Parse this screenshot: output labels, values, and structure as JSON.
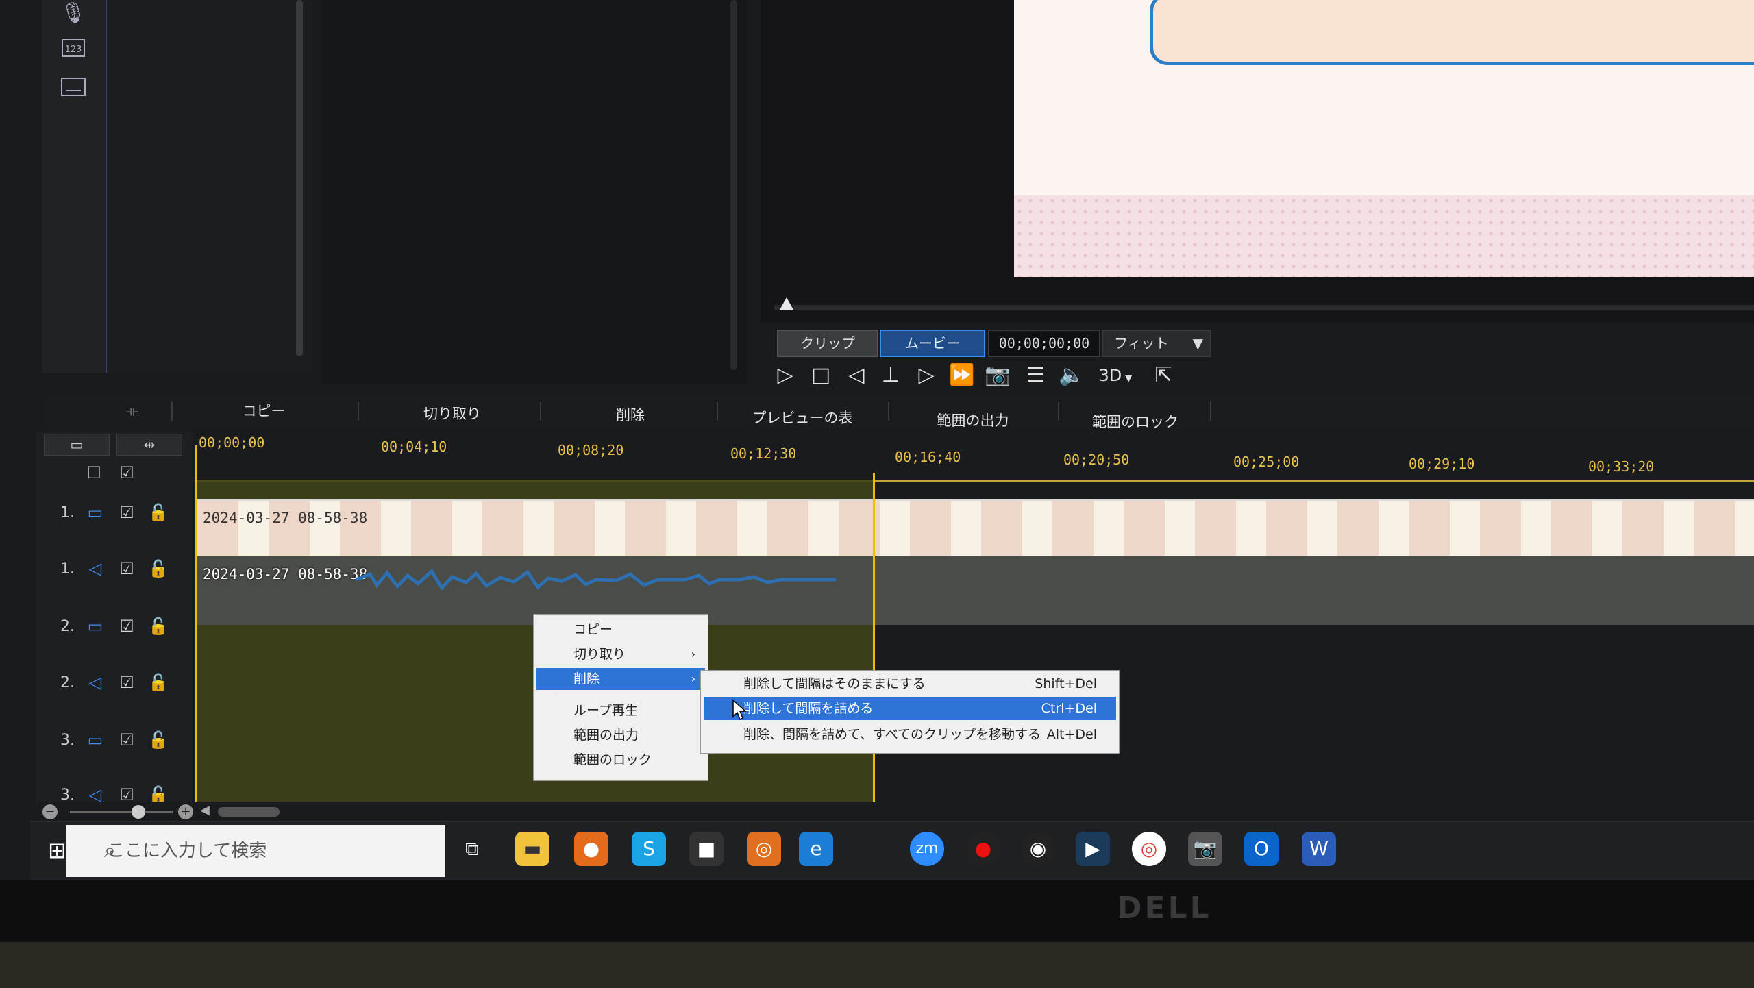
{
  "preview": {
    "segment_clip": "クリップ",
    "segment_movie": "ムービー",
    "timecode": "00;00;00;00",
    "fit_label": "フィット",
    "mode_3d": "3D"
  },
  "toolbar": {
    "copy": "コピー",
    "cut": "切り取り",
    "delete": "削除",
    "show_preview": "プレビューの表示",
    "range_output": "範囲の出力",
    "range_lock": "範囲のロック"
  },
  "ruler": {
    "ticks": [
      "00;00;00",
      "00;04;10",
      "00;08;20",
      "00;12;30",
      "00;16;40",
      "00;20;50",
      "00;25;00",
      "00;29;10",
      "00;33;20"
    ]
  },
  "tracks": [
    {
      "num": "1.",
      "type": "video",
      "clip": "2024-03-27 08-58-38"
    },
    {
      "num": "1.",
      "type": "audio",
      "clip": "2024-03-27 08-58-38"
    },
    {
      "num": "2.",
      "type": "video"
    },
    {
      "num": "2.",
      "type": "audio"
    },
    {
      "num": "3.",
      "type": "video"
    },
    {
      "num": "3.",
      "type": "audio"
    }
  ],
  "context_menu": {
    "items": [
      "コピー",
      "切り取り",
      "削除",
      "ループ再生",
      "範囲の出力",
      "範囲のロック"
    ]
  },
  "submenu": {
    "items": [
      {
        "label": "削除して間隔はそのままにする",
        "shortcut": "Shift+Del"
      },
      {
        "label": "削除して間隔を詰める",
        "shortcut": "Ctrl+Del"
      },
      {
        "label": "削除、間隔を詰めて、すべてのクリップを移動する",
        "shortcut": "Alt+Del"
      }
    ]
  },
  "taskbar": {
    "search_placeholder": "ここに入力して検索",
    "monitor_brand": "DELL"
  },
  "colors": {
    "accent_blue": "#2e74d6",
    "playhead_yellow": "#e8c000",
    "ruler_text": "#e8c24a",
    "selection_region": "#3f4318"
  }
}
